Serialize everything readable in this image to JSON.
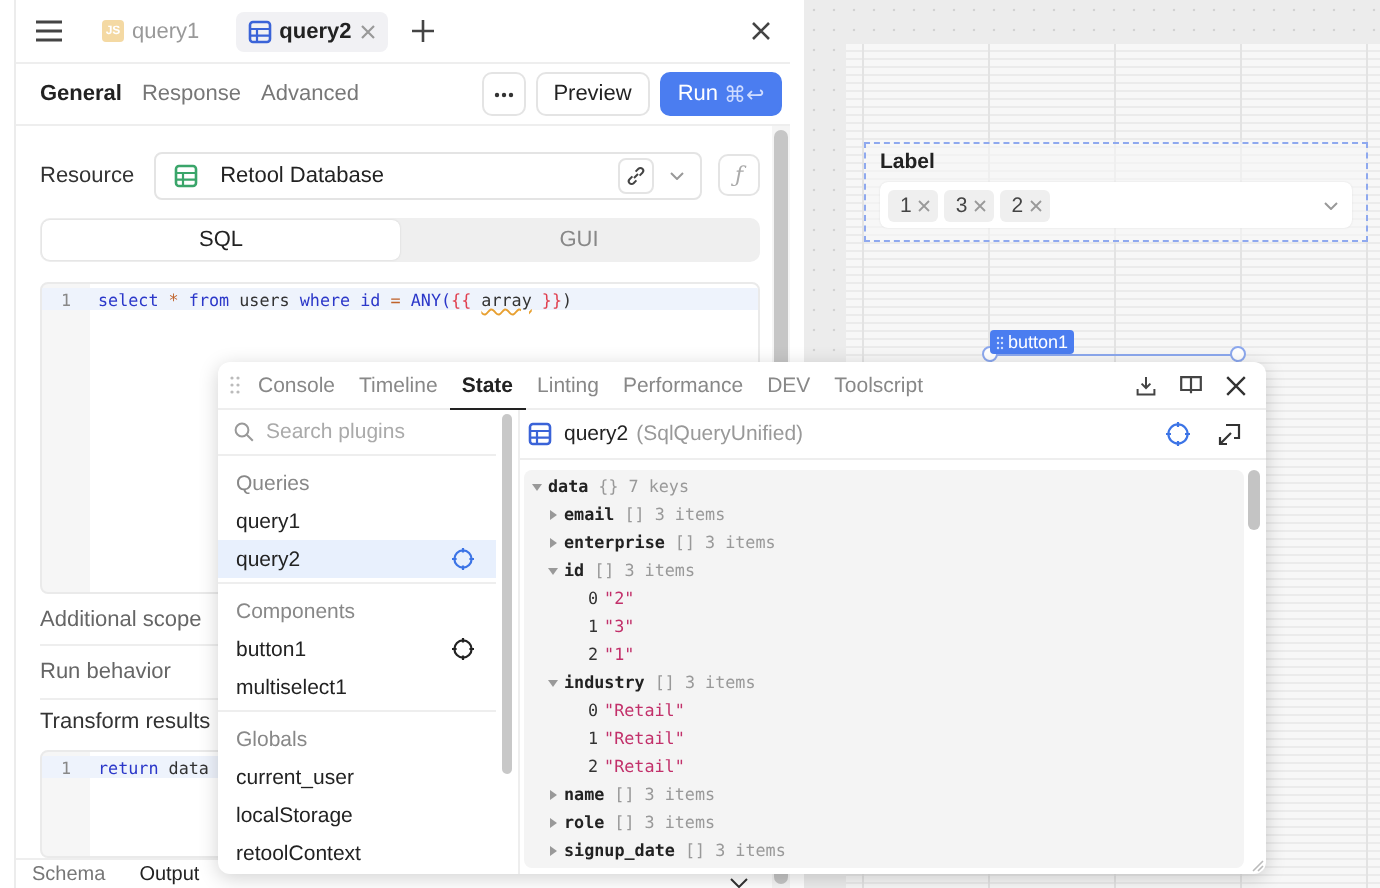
{
  "editor": {
    "tabs": [
      {
        "label": "query1",
        "kind": "js",
        "badge": "JS",
        "selected": false
      },
      {
        "label": "query2",
        "kind": "sql",
        "selected": true
      }
    ],
    "subtabs": [
      {
        "label": "General",
        "selected": true
      },
      {
        "label": "Response",
        "selected": false
      },
      {
        "label": "Advanced",
        "selected": false
      }
    ],
    "preview_button": "Preview",
    "run_button": {
      "label": "Run",
      "shortcut": "⌘↩"
    },
    "resource": {
      "label": "Resource",
      "value": "Retool Database"
    },
    "formula_button": "ƒ",
    "mode_tabs": [
      {
        "label": "SQL",
        "selected": true
      },
      {
        "label": "GUI",
        "selected": false
      }
    ],
    "query_code": [
      {
        "number": "1",
        "tokens": [
          {
            "text": "select",
            "kind": "keyword"
          },
          {
            "text": " *",
            "kind": "operator"
          },
          {
            "text": " from",
            "kind": "keyword"
          },
          {
            "text": " users ",
            "kind": "plain"
          },
          {
            "text": "where id",
            "kind": "keyword"
          },
          {
            "text": " = ",
            "kind": "operator"
          },
          {
            "text": "ANY(",
            "kind": "keyword"
          },
          {
            "text": "{{ ",
            "kind": "template"
          },
          {
            "text": "array",
            "kind": "warning"
          },
          {
            "text": " }}",
            "kind": "template"
          },
          {
            "text": ")",
            "kind": "plain"
          }
        ]
      }
    ],
    "sections": [
      {
        "label": "Additional scope",
        "expanded": false
      },
      {
        "label": "Run behavior",
        "expanded": false
      },
      {
        "label": "Transform results",
        "expanded": true
      }
    ],
    "transform_code": [
      {
        "number": "1",
        "tokens": [
          {
            "text": "return",
            "kind": "keyword"
          },
          {
            "text": " data",
            "kind": "plain"
          }
        ]
      }
    ],
    "output_tabs": [
      {
        "label": "Schema",
        "selected": false
      },
      {
        "label": "Output",
        "selected": true
      }
    ]
  },
  "canvas": {
    "multiselect": {
      "label": "Label",
      "chips": [
        "1",
        "3",
        "2"
      ]
    },
    "selected_component": "button1"
  },
  "debug_panel": {
    "tabs": [
      {
        "label": "Console",
        "selected": false
      },
      {
        "label": "Timeline",
        "selected": false
      },
      {
        "label": "State",
        "selected": true
      },
      {
        "label": "Linting",
        "selected": false
      },
      {
        "label": "Performance",
        "selected": false
      },
      {
        "label": "DEV",
        "selected": false
      },
      {
        "label": "Toolscript",
        "selected": false
      }
    ],
    "search": {
      "placeholder": "Search plugins"
    },
    "groups": [
      {
        "title": "Queries",
        "items": [
          {
            "label": "query1",
            "selected": false,
            "locatable": false
          },
          {
            "label": "query2",
            "selected": true,
            "locatable": true
          }
        ]
      },
      {
        "title": "Components",
        "items": [
          {
            "label": "button1",
            "selected": false,
            "locatable": true
          },
          {
            "label": "multiselect1",
            "selected": false,
            "locatable": false
          }
        ]
      },
      {
        "title": "Globals",
        "items": [
          {
            "label": "current_user",
            "selected": false,
            "locatable": false
          },
          {
            "label": "localStorage",
            "selected": false,
            "locatable": false
          },
          {
            "label": "retoolContext",
            "selected": false,
            "locatable": false
          }
        ]
      }
    ],
    "inspector": {
      "name": "query2",
      "type": "(SqlQueryUnified)",
      "tree": [
        {
          "key": "data",
          "type": "{}",
          "summary": "7 keys",
          "expanded": true,
          "children": [
            {
              "key": "email",
              "type": "[]",
              "summary": "3 items",
              "expanded": false
            },
            {
              "key": "enterprise",
              "type": "[]",
              "summary": "3 items",
              "expanded": false
            },
            {
              "key": "id",
              "type": "[]",
              "summary": "3 items",
              "expanded": true,
              "children": [
                {
                  "key": "0",
                  "value": "\"2\""
                },
                {
                  "key": "1",
                  "value": "\"3\""
                },
                {
                  "key": "2",
                  "value": "\"1\""
                }
              ]
            },
            {
              "key": "industry",
              "type": "[]",
              "summary": "3 items",
              "expanded": true,
              "children": [
                {
                  "key": "0",
                  "value": "\"Retail\""
                },
                {
                  "key": "1",
                  "value": "\"Retail\""
                },
                {
                  "key": "2",
                  "value": "\"Retail\""
                }
              ]
            },
            {
              "key": "name",
              "type": "[]",
              "summary": "3 items",
              "expanded": false
            },
            {
              "key": "role",
              "type": "[]",
              "summary": "3 items",
              "expanded": false
            },
            {
              "key": "signup_date",
              "type": "[]",
              "summary": "3 items",
              "expanded": false
            }
          ]
        }
      ]
    }
  }
}
